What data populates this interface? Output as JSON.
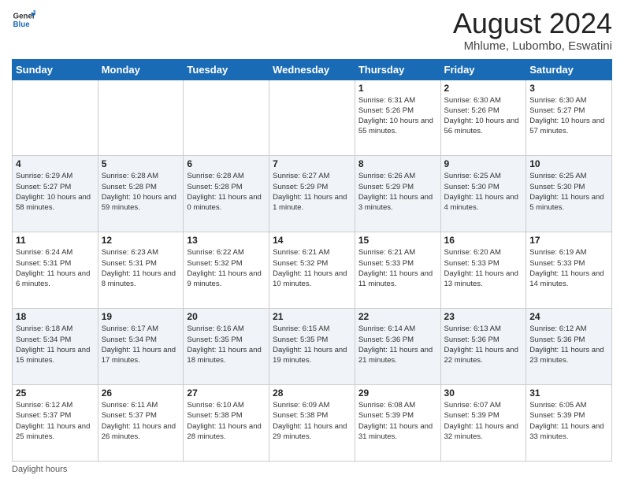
{
  "logo": {
    "general": "General",
    "blue": "Blue"
  },
  "title": "August 2024",
  "subtitle": "Mhlume, Lubombo, Eswatini",
  "days_of_week": [
    "Sunday",
    "Monday",
    "Tuesday",
    "Wednesday",
    "Thursday",
    "Friday",
    "Saturday"
  ],
  "weeks": [
    [
      {
        "day": "",
        "info": ""
      },
      {
        "day": "",
        "info": ""
      },
      {
        "day": "",
        "info": ""
      },
      {
        "day": "",
        "info": ""
      },
      {
        "day": "1",
        "info": "Sunrise: 6:31 AM\nSunset: 5:26 PM\nDaylight: 10 hours and 55 minutes."
      },
      {
        "day": "2",
        "info": "Sunrise: 6:30 AM\nSunset: 5:26 PM\nDaylight: 10 hours and 56 minutes."
      },
      {
        "day": "3",
        "info": "Sunrise: 6:30 AM\nSunset: 5:27 PM\nDaylight: 10 hours and 57 minutes."
      }
    ],
    [
      {
        "day": "4",
        "info": "Sunrise: 6:29 AM\nSunset: 5:27 PM\nDaylight: 10 hours and 58 minutes."
      },
      {
        "day": "5",
        "info": "Sunrise: 6:28 AM\nSunset: 5:28 PM\nDaylight: 10 hours and 59 minutes."
      },
      {
        "day": "6",
        "info": "Sunrise: 6:28 AM\nSunset: 5:28 PM\nDaylight: 11 hours and 0 minutes."
      },
      {
        "day": "7",
        "info": "Sunrise: 6:27 AM\nSunset: 5:29 PM\nDaylight: 11 hours and 1 minute."
      },
      {
        "day": "8",
        "info": "Sunrise: 6:26 AM\nSunset: 5:29 PM\nDaylight: 11 hours and 3 minutes."
      },
      {
        "day": "9",
        "info": "Sunrise: 6:25 AM\nSunset: 5:30 PM\nDaylight: 11 hours and 4 minutes."
      },
      {
        "day": "10",
        "info": "Sunrise: 6:25 AM\nSunset: 5:30 PM\nDaylight: 11 hours and 5 minutes."
      }
    ],
    [
      {
        "day": "11",
        "info": "Sunrise: 6:24 AM\nSunset: 5:31 PM\nDaylight: 11 hours and 6 minutes."
      },
      {
        "day": "12",
        "info": "Sunrise: 6:23 AM\nSunset: 5:31 PM\nDaylight: 11 hours and 8 minutes."
      },
      {
        "day": "13",
        "info": "Sunrise: 6:22 AM\nSunset: 5:32 PM\nDaylight: 11 hours and 9 minutes."
      },
      {
        "day": "14",
        "info": "Sunrise: 6:21 AM\nSunset: 5:32 PM\nDaylight: 11 hours and 10 minutes."
      },
      {
        "day": "15",
        "info": "Sunrise: 6:21 AM\nSunset: 5:33 PM\nDaylight: 11 hours and 11 minutes."
      },
      {
        "day": "16",
        "info": "Sunrise: 6:20 AM\nSunset: 5:33 PM\nDaylight: 11 hours and 13 minutes."
      },
      {
        "day": "17",
        "info": "Sunrise: 6:19 AM\nSunset: 5:33 PM\nDaylight: 11 hours and 14 minutes."
      }
    ],
    [
      {
        "day": "18",
        "info": "Sunrise: 6:18 AM\nSunset: 5:34 PM\nDaylight: 11 hours and 15 minutes."
      },
      {
        "day": "19",
        "info": "Sunrise: 6:17 AM\nSunset: 5:34 PM\nDaylight: 11 hours and 17 minutes."
      },
      {
        "day": "20",
        "info": "Sunrise: 6:16 AM\nSunset: 5:35 PM\nDaylight: 11 hours and 18 minutes."
      },
      {
        "day": "21",
        "info": "Sunrise: 6:15 AM\nSunset: 5:35 PM\nDaylight: 11 hours and 19 minutes."
      },
      {
        "day": "22",
        "info": "Sunrise: 6:14 AM\nSunset: 5:36 PM\nDaylight: 11 hours and 21 minutes."
      },
      {
        "day": "23",
        "info": "Sunrise: 6:13 AM\nSunset: 5:36 PM\nDaylight: 11 hours and 22 minutes."
      },
      {
        "day": "24",
        "info": "Sunrise: 6:12 AM\nSunset: 5:36 PM\nDaylight: 11 hours and 23 minutes."
      }
    ],
    [
      {
        "day": "25",
        "info": "Sunrise: 6:12 AM\nSunset: 5:37 PM\nDaylight: 11 hours and 25 minutes."
      },
      {
        "day": "26",
        "info": "Sunrise: 6:11 AM\nSunset: 5:37 PM\nDaylight: 11 hours and 26 minutes."
      },
      {
        "day": "27",
        "info": "Sunrise: 6:10 AM\nSunset: 5:38 PM\nDaylight: 11 hours and 28 minutes."
      },
      {
        "day": "28",
        "info": "Sunrise: 6:09 AM\nSunset: 5:38 PM\nDaylight: 11 hours and 29 minutes."
      },
      {
        "day": "29",
        "info": "Sunrise: 6:08 AM\nSunset: 5:39 PM\nDaylight: 11 hours and 31 minutes."
      },
      {
        "day": "30",
        "info": "Sunrise: 6:07 AM\nSunset: 5:39 PM\nDaylight: 11 hours and 32 minutes."
      },
      {
        "day": "31",
        "info": "Sunrise: 6:05 AM\nSunset: 5:39 PM\nDaylight: 11 hours and 33 minutes."
      }
    ]
  ],
  "footer": "Daylight hours"
}
